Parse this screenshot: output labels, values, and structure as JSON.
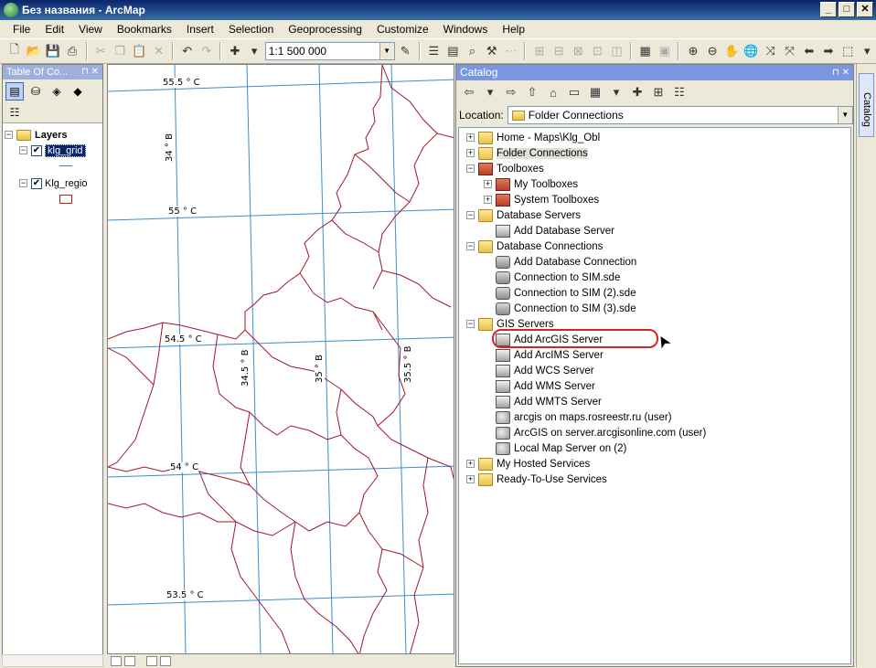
{
  "window": {
    "title": "Без названия - ArcMap",
    "min": "_",
    "max": "□",
    "close": "✕"
  },
  "menu": [
    "File",
    "Edit",
    "View",
    "Bookmarks",
    "Insert",
    "Selection",
    "Geoprocessing",
    "Customize",
    "Windows",
    "Help"
  ],
  "toolbar": {
    "scale": "1:1 500 000"
  },
  "toc": {
    "title": "Table Of Co...",
    "root": "Layers",
    "layers": [
      {
        "name": "klg_grid",
        "checked": "✔",
        "selected": true
      },
      {
        "name": "Klg_regio",
        "checked": "✔",
        "selected": false
      }
    ]
  },
  "map": {
    "grid_labels_h": [
      "55.5 ° C",
      "55 ° C",
      "54.5 ° C",
      "54 ° C",
      "53.5 ° C"
    ],
    "grid_labels_v": [
      "34 ° В",
      "34.5 ° В",
      "35 ° В",
      "35.5 ° В"
    ]
  },
  "catalog": {
    "title": "Catalog",
    "location_label": "Location:",
    "location_value": "Folder Connections",
    "side_tab": "Catalog",
    "tree": [
      {
        "level": 0,
        "expander": "+",
        "icon": "folder-home-icon",
        "label": "Home - Maps\\Klg_Obl"
      },
      {
        "level": 0,
        "expander": "+",
        "icon": "folder-connections-icon",
        "label": "Folder Connections",
        "highlight": true
      },
      {
        "level": 0,
        "expander": "−",
        "icon": "toolbox-icon",
        "label": "Toolboxes"
      },
      {
        "level": 1,
        "expander": "+",
        "icon": "toolbox-icon",
        "label": "My Toolboxes"
      },
      {
        "level": 1,
        "expander": "+",
        "icon": "toolbox-icon",
        "label": "System Toolboxes"
      },
      {
        "level": 0,
        "expander": "−",
        "icon": "database-servers-icon",
        "label": "Database Servers"
      },
      {
        "level": 1,
        "expander": "",
        "icon": "add-server-icon",
        "label": "Add Database Server"
      },
      {
        "level": 0,
        "expander": "−",
        "icon": "database-connections-icon",
        "label": "Database Connections"
      },
      {
        "level": 1,
        "expander": "",
        "icon": "add-connection-icon",
        "label": "Add Database Connection"
      },
      {
        "level": 1,
        "expander": "",
        "icon": "sde-connection-icon",
        "label": "Connection to SIM.sde"
      },
      {
        "level": 1,
        "expander": "",
        "icon": "sde-connection-icon",
        "label": "Connection to SIM (2).sde"
      },
      {
        "level": 1,
        "expander": "",
        "icon": "sde-connection-icon",
        "label": "Connection to SIM (3).sde"
      },
      {
        "level": 0,
        "expander": "−",
        "icon": "gis-servers-icon",
        "label": "GIS Servers"
      },
      {
        "level": 1,
        "expander": "",
        "icon": "add-server-icon",
        "label": "Add ArcGIS Server",
        "ring": true
      },
      {
        "level": 1,
        "expander": "",
        "icon": "add-server-icon",
        "label": "Add ArcIMS Server"
      },
      {
        "level": 1,
        "expander": "",
        "icon": "add-server-icon",
        "label": "Add WCS Server"
      },
      {
        "level": 1,
        "expander": "",
        "icon": "add-server-icon",
        "label": "Add WMS Server"
      },
      {
        "level": 1,
        "expander": "",
        "icon": "add-server-icon",
        "label": "Add WMTS Server"
      },
      {
        "level": 1,
        "expander": "",
        "icon": "arcgis-server-icon",
        "label": "arcgis on maps.rosreestr.ru (user)"
      },
      {
        "level": 1,
        "expander": "",
        "icon": "arcgis-server-icon",
        "label": "ArcGIS on server.arcgisonline.com (user)"
      },
      {
        "level": 1,
        "expander": "",
        "icon": "arcgis-server-icon",
        "label": "Local Map Server on  (2)"
      },
      {
        "level": 0,
        "expander": "+",
        "icon": "hosted-services-icon",
        "label": "My Hosted Services"
      },
      {
        "level": 0,
        "expander": "+",
        "icon": "ready-to-use-icon",
        "label": "Ready-To-Use Services"
      }
    ]
  }
}
